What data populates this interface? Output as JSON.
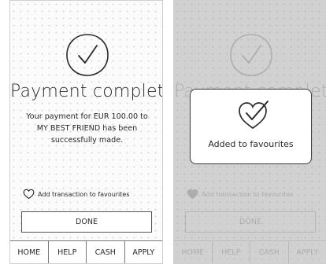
{
  "payment_screen": {
    "title": "Payment complete!",
    "message": "Your payment for EUR 100.00 to MY BEST FRIEND has been successfully made.",
    "favourite_label": "Add transaction to favourites",
    "done_label": "DONE",
    "nav": [
      "HOME",
      "HELP",
      "CASH",
      "APPLY"
    ]
  },
  "modal": {
    "text": "Added to favourites"
  },
  "colors": {
    "ink": "#2a2a2a",
    "background": "#fbfbfb",
    "dim_overlay": "#969696"
  },
  "icons": [
    "checkmark-circle-icon",
    "heart-icon",
    "heart-check-icon"
  ]
}
